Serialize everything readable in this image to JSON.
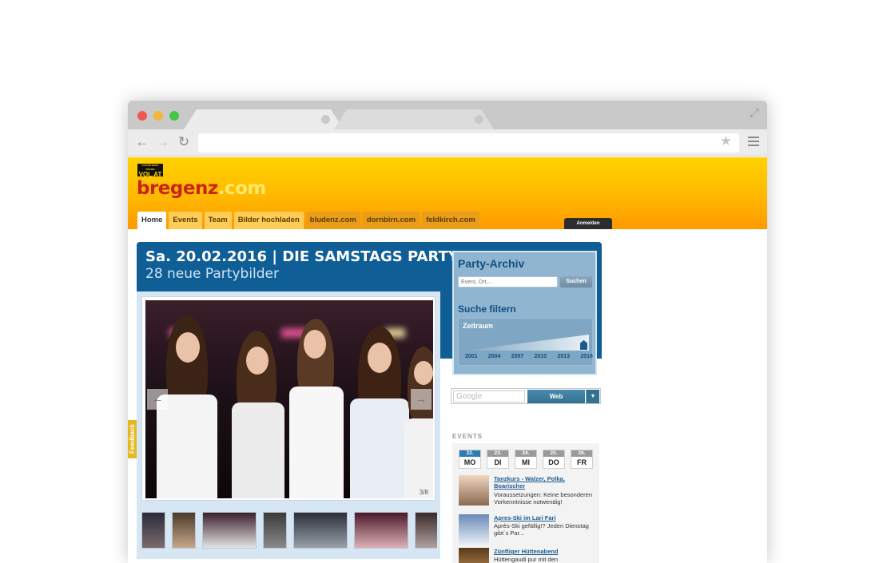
{
  "browser": {
    "url": ""
  },
  "site": {
    "vol_logo_small": "VORARLBERG ONLINE",
    "vol_logo_big": "VOL.AT",
    "brand_main": "bregenz",
    "brand_suffix": ".com",
    "nav": [
      "Home",
      "Events",
      "Team",
      "Bilder hochladen",
      "bludenz.com",
      "dornbirn.com",
      "feldkirch.com"
    ],
    "login_label": "Anmelden",
    "feedback_label": "Feedback"
  },
  "event": {
    "title": "Sa. 20.02.2016 | DIE SAMSTAGS PARTY",
    "subtitle": "28 neue Partybilder",
    "photo_counter": "3/8",
    "prev_arrow": "←",
    "next_arrow": "→"
  },
  "archive": {
    "title": "Party-Archiv",
    "search_placeholder": "Event, Ort,...",
    "search_button": "Suchen",
    "filter_title": "Suche filtern",
    "zeitraum_label": "Zeitraum",
    "years": [
      "2001",
      "2004",
      "2007",
      "2010",
      "2013",
      "2016"
    ],
    "selected_year": "2016"
  },
  "google": {
    "placeholder": "Google",
    "button": "Web",
    "caret": "▼"
  },
  "events": {
    "heading": "EVENTS",
    "days": [
      {
        "num": "22.",
        "wd": "MO",
        "active": true
      },
      {
        "num": "23.",
        "wd": "DI",
        "active": false
      },
      {
        "num": "24.",
        "wd": "MI",
        "active": false
      },
      {
        "num": "25.",
        "wd": "DO",
        "active": false
      },
      {
        "num": "26.",
        "wd": "FR",
        "active": false
      }
    ],
    "items": [
      {
        "title": "Tanzkurs - Walzer, Polka, Boarischer",
        "desc": "Voraussetzungen: Keine besonderen Vorkenntnisse notwendig!"
      },
      {
        "title": "Apres-Ski im Lari Fari",
        "desc": "Après-Ski gefällig!? Jeden Dienstag gibt´s Par..."
      },
      {
        "title": "Zünftiger Hüttenabend",
        "desc": "Hüttengaudi pur mit den"
      }
    ]
  },
  "colors": {
    "header_top": "#ffd200",
    "header_bottom": "#ff9900",
    "event_blue": "#0f5e96",
    "archive_bg": "#8fb5d0",
    "link_blue": "#1c5b8f"
  }
}
